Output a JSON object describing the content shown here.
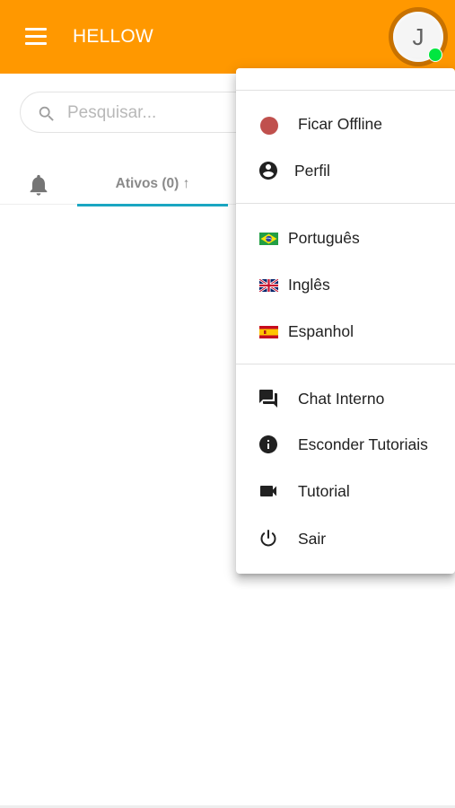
{
  "app": {
    "title": "HELLOW",
    "avatar_initial": "J"
  },
  "colors": {
    "topbar": "#ff9800",
    "tab_indicator": "#1aa6c2",
    "status_online": "#00e640",
    "offline_dot": "#c0504d"
  },
  "search": {
    "placeholder": "Pesquisar...",
    "value": ""
  },
  "tabs": {
    "active_label": "Ativos (0) ↑"
  },
  "menu": {
    "offline": "Ficar Offline",
    "profile": "Perfil",
    "lang_pt": "Português",
    "lang_en": "Inglês",
    "lang_es": "Espanhol",
    "chat": "Chat Interno",
    "hide_tutorials": "Esconder Tutoriais",
    "tutorial": "Tutorial",
    "logout": "Sair"
  },
  "icons": {
    "menu": "hamburger-icon",
    "search": "search-icon",
    "bell": "bell-icon",
    "profile": "account-circle-icon",
    "chat": "forum-icon",
    "info": "info-icon",
    "video": "videocam-icon",
    "power": "power-icon"
  }
}
